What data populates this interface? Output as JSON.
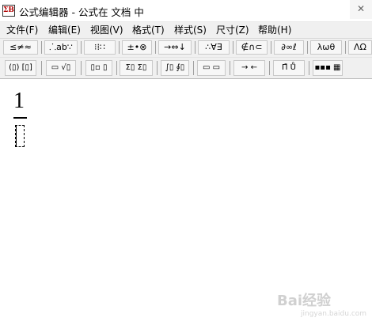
{
  "window": {
    "title": "公式编辑器 - 公式在 文档 中",
    "app_icon_glyph": "ΣB",
    "close_glyph": "✕"
  },
  "menu": [
    {
      "label": "文件(F)"
    },
    {
      "label": "编辑(E)"
    },
    {
      "label": "视图(V)"
    },
    {
      "label": "格式(T)"
    },
    {
      "label": "样式(S)"
    },
    {
      "label": "尺寸(Z)"
    },
    {
      "label": "帮助(H)"
    }
  ],
  "toolbar_row1": [
    {
      "label": "≤≠≈",
      "icon": "relations-palette-icon"
    },
    {
      "label": "⸫ab∵",
      "icon": "spaces-ellipses-palette-icon"
    },
    {
      "label": "⁝⁞∷",
      "icon": "embellishments-palette-icon"
    },
    {
      "label": "±•⊗",
      "icon": "operators-palette-icon"
    },
    {
      "label": "→⇔↓",
      "icon": "arrows-palette-icon"
    },
    {
      "label": "∴∀∃",
      "icon": "logic-palette-icon"
    },
    {
      "label": "∉∩⊂",
      "icon": "set-theory-palette-icon"
    },
    {
      "label": "∂∞ℓ",
      "icon": "misc-symbols-palette-icon"
    },
    {
      "label": "λωθ",
      "icon": "greek-lowercase-palette-icon"
    },
    {
      "label": "ΛΩ",
      "icon": "greek-uppercase-palette-icon"
    }
  ],
  "toolbar_row2": [
    {
      "label": "(▯) [▯]",
      "icon": "fence-templates-icon"
    },
    {
      "label": "▭ √▯",
      "icon": "fraction-radical-templates-icon"
    },
    {
      "label": "▯▫ ▯",
      "icon": "script-templates-icon"
    },
    {
      "label": "Σ▯ Σ▯",
      "icon": "summation-templates-icon"
    },
    {
      "label": "∫▯ ∮▯",
      "icon": "integral-templates-icon"
    },
    {
      "label": "▭ ▭",
      "icon": "overbar-underbar-templates-icon"
    },
    {
      "label": "→ ←",
      "icon": "labeled-arrow-templates-icon"
    },
    {
      "label": "Π̄ Ů",
      "icon": "products-set-templates-icon"
    },
    {
      "label": "▪▪▪ ▦",
      "icon": "matrix-templates-icon"
    }
  ],
  "editor": {
    "numerator": "1"
  },
  "watermark": {
    "text": "Bai经验",
    "subtext": "jingyan.baidu.com"
  }
}
